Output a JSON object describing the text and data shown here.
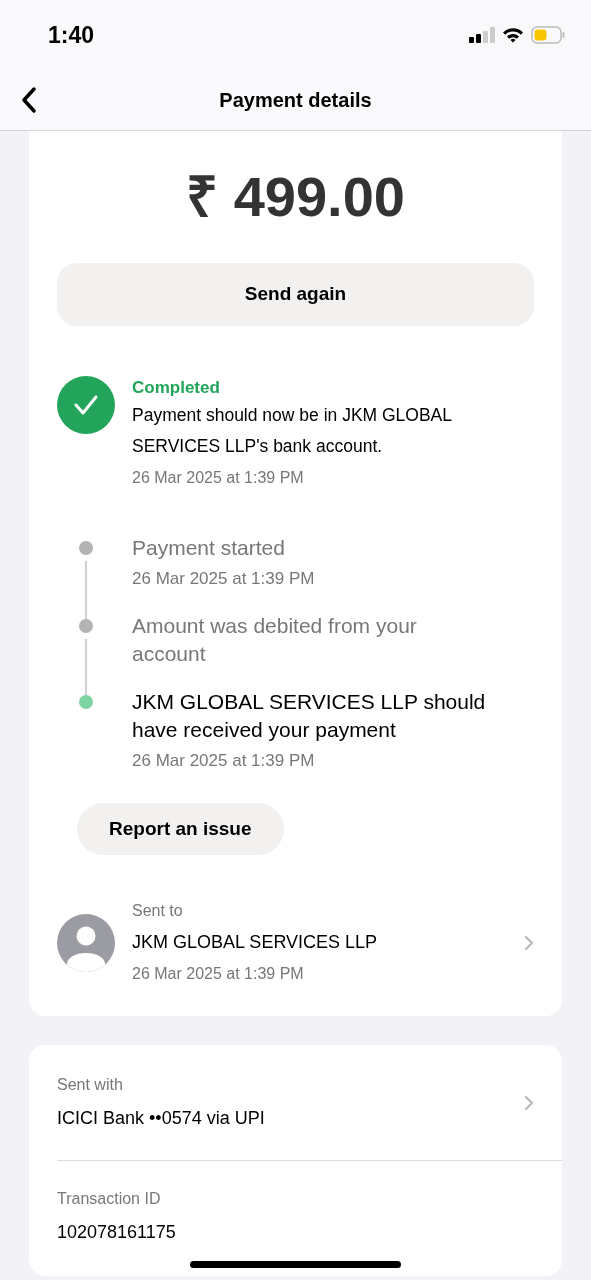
{
  "status_bar": {
    "time": "1:40"
  },
  "nav": {
    "title": "Payment details"
  },
  "amount": "₹ 499.00",
  "send_again": "Send again",
  "status": {
    "label": "Completed",
    "message": "Payment should now be in JKM GLOBAL SERVICES LLP's bank account.",
    "date": "26 Mar 2025 at 1:39 PM"
  },
  "timeline": [
    {
      "title": "Payment started",
      "date": "26 Mar 2025 at 1:39 PM",
      "current": false
    },
    {
      "title": "Amount was debited from your account",
      "current": false
    },
    {
      "title": "JKM GLOBAL SERVICES LLP should have received your payment",
      "date": "26 Mar 2025 at 1:39 PM",
      "current": true
    }
  ],
  "report_issue": "Report an issue",
  "sent_to": {
    "label": "Sent to",
    "name": "JKM GLOBAL SERVICES LLP",
    "date": "26 Mar 2025 at 1:39 PM"
  },
  "details": [
    {
      "label": "Sent with",
      "value": "ICICI Bank ••0574 via UPI",
      "link": true
    },
    {
      "label": "Transaction ID",
      "value": "102078161175",
      "link": false
    }
  ]
}
